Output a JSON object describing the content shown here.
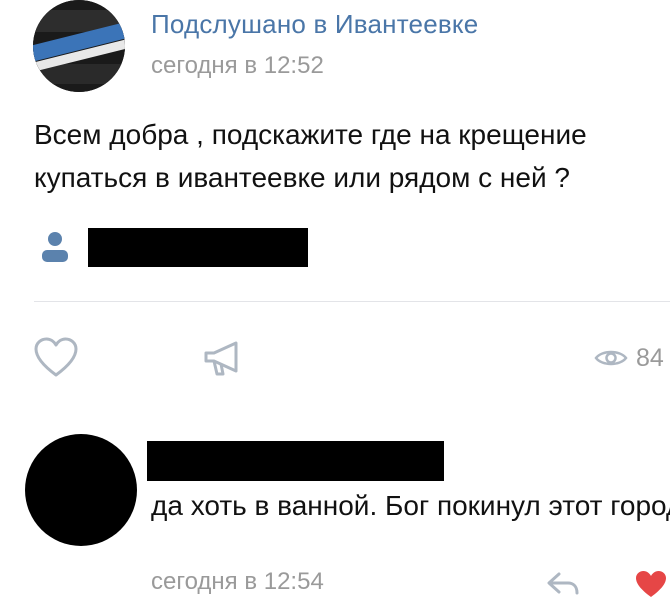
{
  "post": {
    "group_name": "Подслушано в  Ивантеевке",
    "time": "сегодня в 12:52",
    "text": "Всем добра , подскажите где на крещение купаться в ивантеевке или рядом с ней ?",
    "avatar_logo_lines": [
      "ПОДСЛУШАНО",
      "В ИВАНТЕЕВКЕ"
    ]
  },
  "actions": {
    "like_icon": "heart-outline-icon",
    "share_icon": "megaphone-icon",
    "views_icon": "eye-icon",
    "views_count": "84"
  },
  "comment": {
    "text": "да хоть в ванной. Бог покинул этот город",
    "time": "сегодня в 12:54",
    "reply_icon": "reply-arrow-icon",
    "like_icon": "heart-filled-icon",
    "like_color": "#e64646"
  },
  "colors": {
    "link": "#4a76a8",
    "secondary": "#9a9a9a",
    "icon": "#aeb7c2"
  }
}
